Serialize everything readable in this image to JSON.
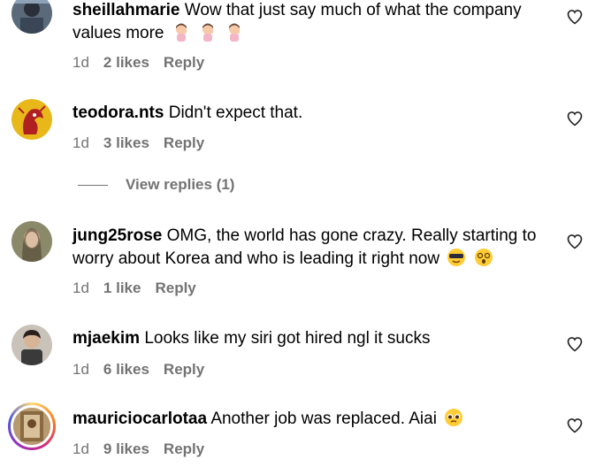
{
  "comments": [
    {
      "username": "sheillahmarie",
      "text": "Wow that just say much of what the company values more",
      "emojis": [
        "person-facepalming",
        "person-facepalming",
        "person-facepalming"
      ],
      "time": "1d",
      "likes": "2 likes",
      "reply": "Reply"
    },
    {
      "username": "teodora.nts",
      "text": "Didn't expect that.",
      "time": "1d",
      "likes": "3 likes",
      "reply": "Reply",
      "view_replies": "View replies (1)"
    },
    {
      "username": "jung25rose",
      "text": "OMG, the world has gone crazy. Really starting to worry about Korea and who is leading it right now",
      "emojis": [
        "smiling-face-with-sunglasses",
        "dizzy-face"
      ],
      "time": "1d",
      "likes": "1 like",
      "reply": "Reply"
    },
    {
      "username": "mjaekim",
      "text": "Looks like my siri got hired ngl it sucks",
      "time": "1d",
      "likes": "6 likes",
      "reply": "Reply"
    },
    {
      "username": "mauriciocarlotaa",
      "text": "Another job was replaced. Aiai",
      "emojis": [
        "pleading-face"
      ],
      "time": "1d",
      "likes": "9 likes",
      "reply": "Reply"
    }
  ],
  "colors": {
    "meta_gray": "#737373",
    "text": "#000000",
    "background": "#ffffff"
  }
}
